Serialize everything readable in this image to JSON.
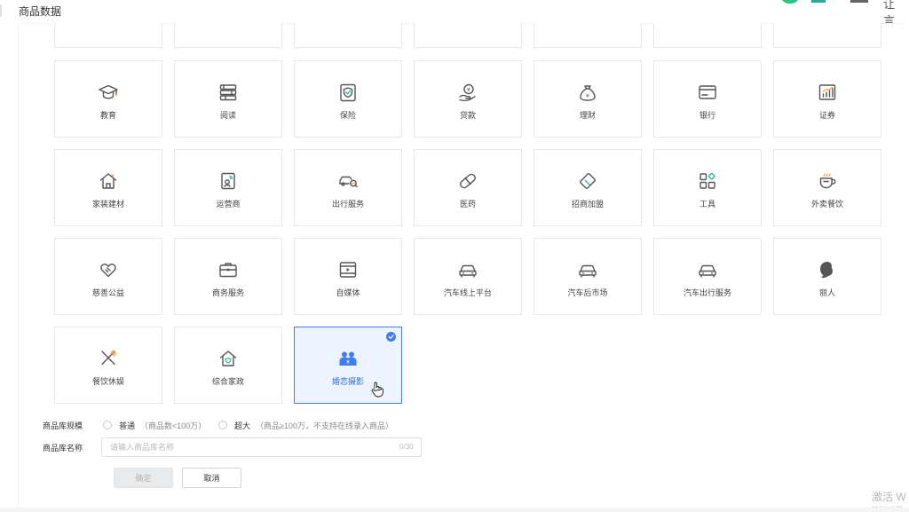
{
  "header": {
    "title": "商品数据",
    "top_right_text": "让 言"
  },
  "industries": {
    "partial_row_count": 7,
    "rows": [
      [
        {
          "label": "教育",
          "icon": "graduation-cap-icon"
        },
        {
          "label": "阅读",
          "icon": "books-icon"
        },
        {
          "label": "保险",
          "icon": "insurance-shield-icon"
        },
        {
          "label": "贷款",
          "icon": "loan-hand-coin-icon"
        },
        {
          "label": "理财",
          "icon": "money-bag-icon"
        },
        {
          "label": "银行",
          "icon": "bank-card-icon"
        },
        {
          "label": "证券",
          "icon": "stock-chart-icon"
        }
      ],
      [
        {
          "label": "家装建材",
          "icon": "house-icon"
        },
        {
          "label": "运营商",
          "icon": "phone-signal-icon"
        },
        {
          "label": "出行服务",
          "icon": "car-search-icon"
        },
        {
          "label": "医药",
          "icon": "pill-icon"
        },
        {
          "label": "招商加盟",
          "icon": "handshake-tag-icon"
        },
        {
          "label": "工具",
          "icon": "tools-grid-icon"
        },
        {
          "label": "外卖餐饮",
          "icon": "coffee-cup-icon"
        }
      ],
      [
        {
          "label": "慈善公益",
          "icon": "heart-hand-icon"
        },
        {
          "label": "商务服务",
          "icon": "briefcase-icon"
        },
        {
          "label": "自媒体",
          "icon": "video-play-icon"
        },
        {
          "label": "汽车线上平台",
          "icon": "car-icon"
        },
        {
          "label": "汽车后市场",
          "icon": "car-icon"
        },
        {
          "label": "汽车出行服务",
          "icon": "car-icon"
        },
        {
          "label": "丽人",
          "icon": "woman-profile-icon"
        }
      ],
      [
        {
          "label": "餐饮休娱",
          "icon": "fork-knife-icon"
        },
        {
          "label": "综合家政",
          "icon": "home-shield-icon"
        },
        {
          "label": "婚恋摄影",
          "icon": "couple-icon",
          "selected": true
        }
      ]
    ]
  },
  "form": {
    "scale_label": "商品库规模",
    "scale_options": [
      {
        "label": "普通",
        "hint": "（商品数<100万）"
      },
      {
        "label": "超大",
        "hint": "（商品≥100万，不支持在线录入商品）"
      }
    ],
    "name_label": "商品库名称",
    "name_value": "",
    "name_placeholder": "请输入商品库名称",
    "name_counter": "0/30",
    "confirm_label": "确定",
    "cancel_label": "取消"
  },
  "watermark": {
    "text": "激活 W",
    "sub": "转到\"设置"
  },
  "colors": {
    "accent": "#3d7ef0",
    "selected_bg": "#eef4ff",
    "border": "#e8e8e8",
    "icon_stroke": "#555555"
  }
}
